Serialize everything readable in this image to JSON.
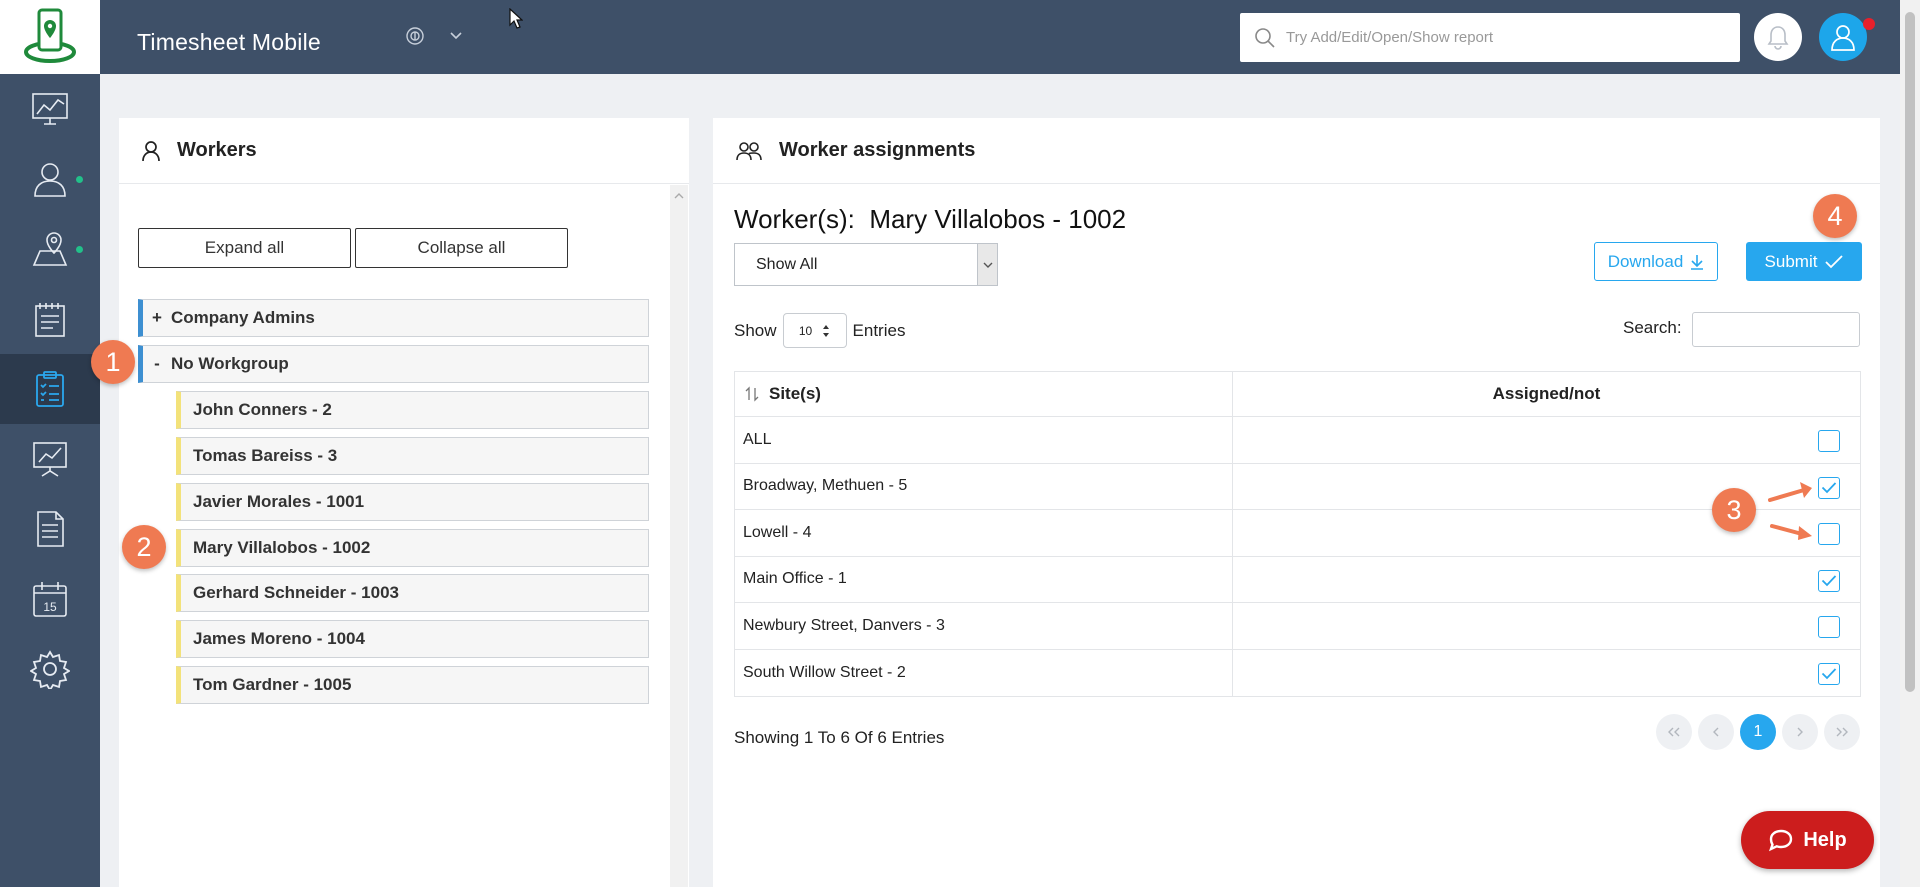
{
  "app": {
    "title": "Timesheet Mobile"
  },
  "topbar": {
    "search_placeholder": "Try Add/Edit/Open/Show report",
    "colors": {
      "bar": "#3e5068",
      "accent": "#1da6ea",
      "notification": "#e8202b"
    }
  },
  "sidebar": {
    "items": [
      {
        "icon": "dashboard-chart-icon"
      },
      {
        "icon": "workers-icon",
        "dot": true
      },
      {
        "icon": "map-location-icon",
        "dot": true
      },
      {
        "icon": "clipboard-notes-icon"
      },
      {
        "icon": "checklist-clipboard-icon",
        "active": true
      },
      {
        "icon": "presentation-chart-icon"
      },
      {
        "icon": "document-icon"
      },
      {
        "icon": "calendar-icon",
        "calendar_day": "15"
      },
      {
        "icon": "gear-icon"
      }
    ]
  },
  "workers_panel": {
    "title": "Workers",
    "expand_label": "Expand all",
    "collapse_label": "Collapse all",
    "groups": [
      {
        "toggle": "+",
        "name": "Company Admins"
      },
      {
        "toggle": "-",
        "name": "No Workgroup"
      }
    ],
    "workers": [
      "John Conners - 2",
      "Tomas Bareiss - 3",
      "Javier Morales - 1001",
      "Mary Villalobos - 1002",
      "Gerhard Schneider - 1003",
      "James Moreno - 1004",
      "Tom Gardner - 1005"
    ]
  },
  "assign_panel": {
    "title": "Worker assignments",
    "heading_label": "Worker(s):",
    "heading_worker": "Mary Villalobos - 1002",
    "filter_value": "Show All",
    "download_label": "Download",
    "submit_label": "Submit",
    "show_label": "Show",
    "entries_value": "10",
    "entries_label": "Entries",
    "search_label": "Search:",
    "columns": {
      "site": "Site(s)",
      "assigned": "Assigned/not"
    },
    "rows": [
      {
        "site": "ALL",
        "checked": false
      },
      {
        "site": "Broadway, Methuen - 5",
        "checked": true
      },
      {
        "site": "Lowell - 4",
        "checked": false
      },
      {
        "site": "Main Office - 1",
        "checked": true
      },
      {
        "site": "Newbury Street, Danvers - 3",
        "checked": false
      },
      {
        "site": "South Willow Street - 2",
        "checked": true
      }
    ],
    "showing_text": "Showing 1 To 6 Of 6 Entries",
    "current_page": "1"
  },
  "annotations": {
    "b1": "1",
    "b2": "2",
    "b3": "3",
    "b4": "4",
    "color": "#ef7a52"
  },
  "help_label": "Help"
}
